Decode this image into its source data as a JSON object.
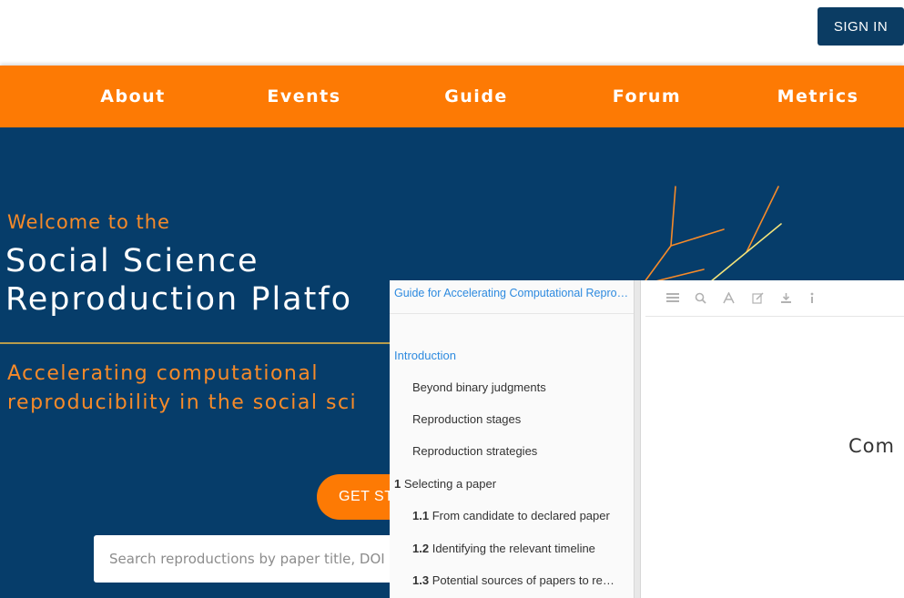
{
  "header": {
    "sign_in_label": "SIGN IN"
  },
  "nav": {
    "items": [
      "About",
      "Events",
      "Guide",
      "Forum",
      "Metrics"
    ]
  },
  "hero": {
    "welcome": "Welcome to the",
    "title_line1": "Social Science",
    "title_line2": "Reproduction Platfo",
    "subtitle_line1": "Accelerating computational",
    "subtitle_line2": "reproducibility in the social sci",
    "cta_label": "GET STARTED",
    "search_placeholder": "Search reproductions by paper title, DOI"
  },
  "reader": {
    "book_title": "Guide for Accelerating Computational Reproducibility in the Social Sciences",
    "toolbar_icons": [
      "menu-icon",
      "search-icon",
      "font-icon",
      "edit-icon",
      "download-icon",
      "info-icon"
    ],
    "toc": [
      {
        "num": "",
        "label": "Introduction",
        "active": true,
        "level": 0
      },
      {
        "num": "",
        "label": "Beyond binary judgments",
        "active": false,
        "level": 1
      },
      {
        "num": "",
        "label": "Reproduction stages",
        "active": false,
        "level": 1
      },
      {
        "num": "",
        "label": "Reproduction strategies",
        "active": false,
        "level": 1
      },
      {
        "num": "1",
        "label": "Selecting a paper",
        "active": false,
        "level": 0
      },
      {
        "num": "1.1",
        "label": "From candidate to declared paper",
        "active": false,
        "level": 1
      },
      {
        "num": "1.2",
        "label": "Identifying the relevant timeline",
        "active": false,
        "level": 1
      },
      {
        "num": "1.3",
        "label": "Potential sources of papers to reproduce",
        "active": false,
        "level": 1
      }
    ],
    "chapter_heading": "Com"
  },
  "colors": {
    "navy": "#063d6a",
    "orange": "#fd7a04",
    "link_blue": "#2d8adf"
  }
}
